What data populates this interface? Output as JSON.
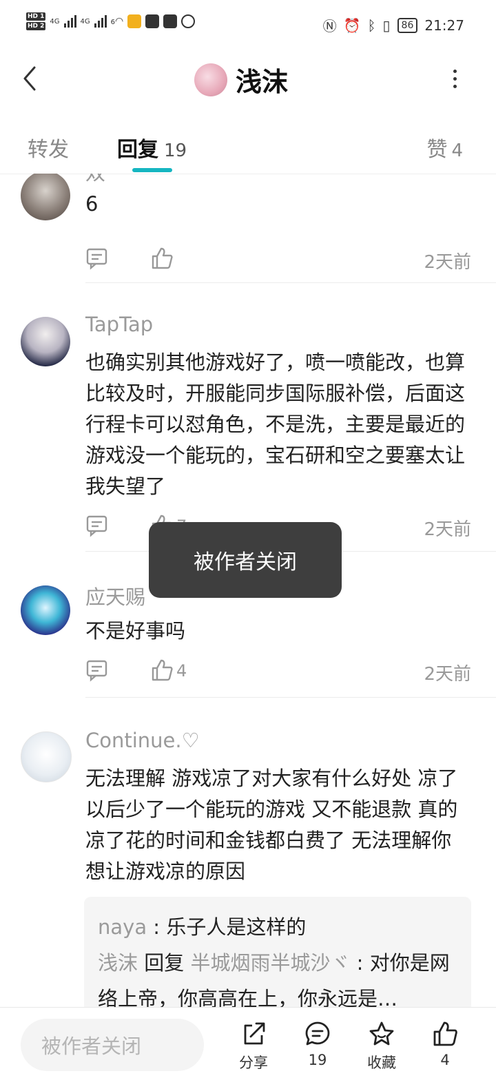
{
  "status_bar": {
    "hd1": "HD 1",
    "hd2": "HD 2",
    "net1": "4G",
    "net2": "4G",
    "wifi_label": "6",
    "battery": "86",
    "time": "21:27"
  },
  "header": {
    "title": "浅沫",
    "avatar_icon": "user-avatar-icon"
  },
  "tabs": {
    "forward_label": "转发",
    "reply_label": "回复",
    "reply_count": "19",
    "like_label": "赞",
    "like_count": "4",
    "accent_color": "#16b6c1"
  },
  "comments": [
    {
      "user": "双一",
      "text": "6",
      "like_count": "",
      "time": "2天前"
    },
    {
      "user": "TapTap",
      "text": "也确实别其他游戏好了，喷一喷能改，也算比较及时，开服能同步国际服补偿，后面这行程卡可以怼角色，不是洗，主要是最近的游戏没一个能玩的，宝石研和空之要塞太让我失望了",
      "like_count": "7",
      "time": "2天前"
    },
    {
      "user": "应天赐",
      "text": "不是好事吗",
      "like_count": "4",
      "time": "2天前"
    },
    {
      "user": "Continue.♡",
      "text": "无法理解 游戏凉了对大家有什么好处 凉了以后少了一个能玩的游戏 又不能退款 真的凉了花的时间和金钱都白费了 无法理解你想让游戏凉的原因"
    }
  ],
  "nested_replies": [
    {
      "name": "naya",
      "sep": " : ",
      "text": "乐子人是这样的"
    },
    {
      "name": "浅沫",
      "verb": " 回复 ",
      "target": "半城烟雨半城沙ヾ",
      "sep": " : ",
      "text": "对你是网络上帝，你高高在上，你永远是…"
    }
  ],
  "toast": {
    "message": "被作者关闭"
  },
  "bottom_bar": {
    "input_placeholder": "被作者关闭",
    "share_label": "分享",
    "comment_count": "19",
    "favorite_label": "收藏",
    "like_count": "4"
  }
}
